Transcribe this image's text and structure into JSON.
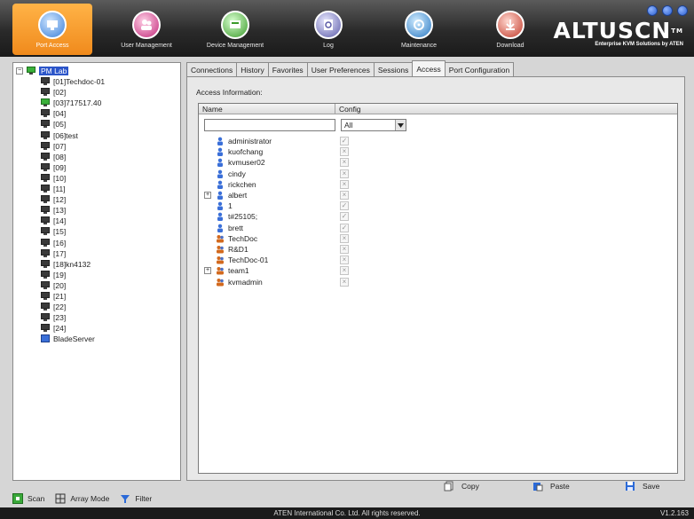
{
  "nav": [
    {
      "label": "Port Access",
      "icon": "port-access-icon",
      "active": true
    },
    {
      "label": "User Management",
      "icon": "user-management-icon",
      "active": false
    },
    {
      "label": "Device Management",
      "icon": "device-management-icon",
      "active": false
    },
    {
      "label": "Log",
      "icon": "log-icon",
      "active": false
    },
    {
      "label": "Maintenance",
      "icon": "maintenance-icon",
      "active": false
    },
    {
      "label": "Download",
      "icon": "download-icon",
      "active": false
    }
  ],
  "logo": {
    "main": "ALTUSCN",
    "tm": "TM",
    "sub": "Enterprise KVM Solutions by ATEN"
  },
  "tree": {
    "root": "PM Lab",
    "ports": [
      {
        "label": "[01]Techdoc-01",
        "icon": "monitor-icon"
      },
      {
        "label": "[02]",
        "icon": "monitor-icon"
      },
      {
        "label": "[03]717517.40",
        "icon": "monitor-online-icon"
      },
      {
        "label": "[04]",
        "icon": "monitor-icon"
      },
      {
        "label": "[05]",
        "icon": "monitor-icon"
      },
      {
        "label": "[06]test",
        "icon": "monitor-icon"
      },
      {
        "label": "[07]",
        "icon": "monitor-icon"
      },
      {
        "label": "[08]",
        "icon": "monitor-icon"
      },
      {
        "label": "[09]",
        "icon": "monitor-icon"
      },
      {
        "label": "[10]",
        "icon": "monitor-icon"
      },
      {
        "label": "[11]",
        "icon": "monitor-icon"
      },
      {
        "label": "[12]",
        "icon": "monitor-icon"
      },
      {
        "label": "[13]",
        "icon": "monitor-icon"
      },
      {
        "label": "[14]",
        "icon": "monitor-icon"
      },
      {
        "label": "[15]",
        "icon": "monitor-icon"
      },
      {
        "label": "[16]",
        "icon": "monitor-icon"
      },
      {
        "label": "[17]",
        "icon": "monitor-icon"
      },
      {
        "label": "[18]kn4132",
        "icon": "monitor-icon"
      },
      {
        "label": "[19]",
        "icon": "monitor-icon"
      },
      {
        "label": "[20]",
        "icon": "monitor-icon"
      },
      {
        "label": "[21]",
        "icon": "monitor-icon"
      },
      {
        "label": "[22]",
        "icon": "monitor-icon"
      },
      {
        "label": "[23]",
        "icon": "monitor-icon"
      },
      {
        "label": "[24]",
        "icon": "monitor-icon"
      },
      {
        "label": "BladeServer",
        "icon": "blade-server-icon"
      }
    ]
  },
  "left_toolbar": {
    "scan": "Scan",
    "array_mode": "Array Mode",
    "filter": "Filter"
  },
  "tabs": [
    "Connections",
    "History",
    "Favorites",
    "User Preferences",
    "Sessions",
    "Access",
    "Port Configuration"
  ],
  "active_tab": "Access",
  "access": {
    "label": "Access Information:",
    "col_name": "Name",
    "col_config": "Config",
    "filter_value": "",
    "config_filter": "All",
    "rows": [
      {
        "name": "administrator",
        "type": "user",
        "config": "check",
        "expandable": false
      },
      {
        "name": "kuofchang",
        "type": "user",
        "config": "x",
        "expandable": false
      },
      {
        "name": "kvmuser02",
        "type": "user",
        "config": "x",
        "expandable": false
      },
      {
        "name": "cindy",
        "type": "user",
        "config": "x",
        "expandable": false
      },
      {
        "name": "rickchen",
        "type": "user",
        "config": "x",
        "expandable": false
      },
      {
        "name": "albert",
        "type": "user",
        "config": "x",
        "expandable": true
      },
      {
        "name": "1",
        "type": "user",
        "config": "check",
        "expandable": false
      },
      {
        "name": "t#25105;",
        "type": "user",
        "config": "check",
        "expandable": false
      },
      {
        "name": "brett",
        "type": "user",
        "config": "check",
        "expandable": false
      },
      {
        "name": "TechDoc",
        "type": "group",
        "config": "x",
        "expandable": false
      },
      {
        "name": "R&D1",
        "type": "group",
        "config": "x",
        "expandable": false
      },
      {
        "name": "TechDoc-01",
        "type": "group",
        "config": "x",
        "expandable": false
      },
      {
        "name": "team1",
        "type": "group",
        "config": "x",
        "expandable": true
      },
      {
        "name": "kvmadmin",
        "type": "group",
        "config": "x",
        "expandable": false
      }
    ]
  },
  "actions": {
    "copy": "Copy",
    "paste": "Paste",
    "save": "Save"
  },
  "status": {
    "copyright": "ATEN International Co. Ltd. All rights reserved.",
    "version": "V1.2.163"
  },
  "colors": {
    "accent": "#f08a1c",
    "selection": "#2b55c9",
    "header": "#2a2a2a"
  }
}
